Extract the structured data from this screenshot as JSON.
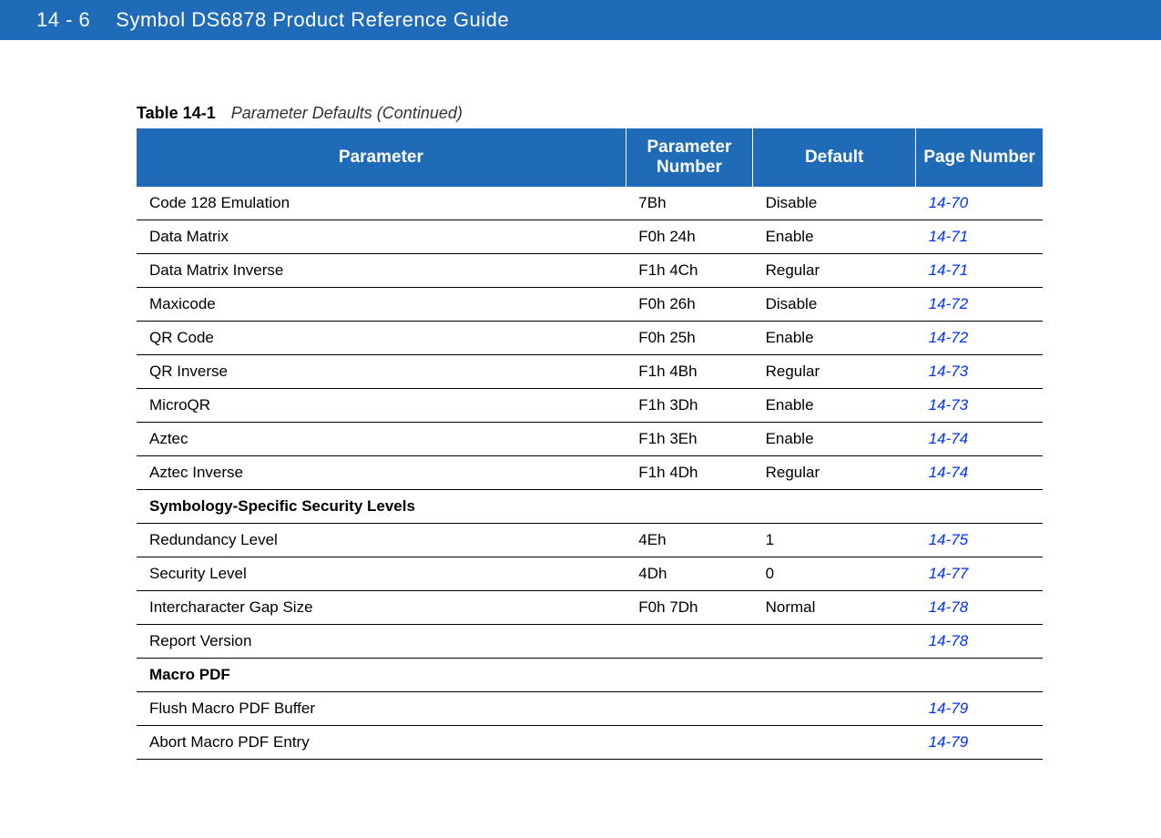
{
  "header": {
    "page_number": "14 - 6",
    "doc_title": "Symbol DS6878 Product Reference Guide"
  },
  "table": {
    "label": "Table 14-1",
    "title": "Parameter Defaults (Continued)",
    "columns": {
      "c0": "Parameter",
      "c1": "Parameter Number",
      "c2": "Default",
      "c3": "Page Number"
    },
    "rows": [
      {
        "type": "data",
        "param": "Code 128 Emulation",
        "num": "7Bh",
        "def": "Disable",
        "page": "14-70"
      },
      {
        "type": "data",
        "param": "Data Matrix",
        "num": "F0h 24h",
        "def": "Enable",
        "page": "14-71"
      },
      {
        "type": "data",
        "param": "Data Matrix Inverse",
        "num": "F1h 4Ch",
        "def": "Regular",
        "page": "14-71"
      },
      {
        "type": "data",
        "param": "Maxicode",
        "num": "F0h 26h",
        "def": "Disable",
        "page": "14-72"
      },
      {
        "type": "data",
        "param": "QR Code",
        "num": "F0h 25h",
        "def": "Enable",
        "page": "14-72"
      },
      {
        "type": "data",
        "param": "QR Inverse",
        "num": "F1h 4Bh",
        "def": "Regular",
        "page": "14-73"
      },
      {
        "type": "data",
        "param": "MicroQR",
        "num": "F1h 3Dh",
        "def": "Enable",
        "page": "14-73"
      },
      {
        "type": "data",
        "param": "Aztec",
        "num": "F1h 3Eh",
        "def": "Enable",
        "page": "14-74"
      },
      {
        "type": "data",
        "param": "Aztec Inverse",
        "num": "F1h 4Dh",
        "def": "Regular",
        "page": "14-74"
      },
      {
        "type": "section",
        "param": "Symbology-Specific Security Levels"
      },
      {
        "type": "data",
        "param": "Redundancy Level",
        "num": "4Eh",
        "def": "1",
        "page": "14-75"
      },
      {
        "type": "data",
        "param": "Security Level",
        "num": "4Dh",
        "def": "0",
        "page": "14-77"
      },
      {
        "type": "data",
        "param": "Intercharacter Gap Size",
        "num": "F0h 7Dh",
        "def": "Normal",
        "page": "14-78"
      },
      {
        "type": "data",
        "param": "Report Version",
        "num": "",
        "def": "",
        "page": "14-78"
      },
      {
        "type": "section",
        "param": "Macro PDF"
      },
      {
        "type": "data",
        "param": "Flush Macro PDF Buffer",
        "num": "",
        "def": "",
        "page": "14-79"
      },
      {
        "type": "data",
        "param": "Abort Macro PDF Entry",
        "num": "",
        "def": "",
        "page": "14-79"
      }
    ]
  }
}
